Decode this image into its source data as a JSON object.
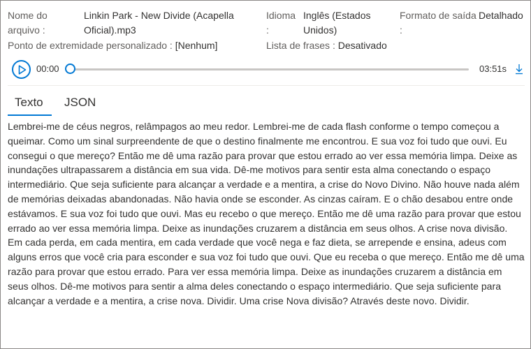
{
  "meta": {
    "filename_label": "Nome do arquivo :",
    "filename_value": "Linkin Park - New Divide (Acapella Oficial).mp3",
    "language_label": "Idioma :",
    "language_value": "Inglês (Estados Unidos)",
    "output_label": "Formato de saída :",
    "output_value": "Detalhado",
    "endpoint_label": "Ponto de extremidade personalizado :",
    "endpoint_value": "[Nenhum]",
    "phrases_label": "Lista de frases :",
    "phrases_value": "Desativado"
  },
  "player": {
    "current_time": "00:00",
    "total_time": "03:51s",
    "progress": 0,
    "play_icon": "play-icon",
    "download_icon": "download-icon"
  },
  "tabs": [
    {
      "label": "Texto",
      "active": true
    },
    {
      "label": "JSON",
      "active": false
    }
  ],
  "transcript": "Lembrei-me de céus negros, relâmpagos ao meu redor. Lembrei-me de cada flash conforme o tempo começou a queimar. Como um sinal surpreendente de que o destino finalmente me encontrou. E sua voz foi tudo que ouvi. Eu consegui o que mereço? Então me dê uma razão para provar que estou errado ao ver essa memória limpa. Deixe as inundações ultrapassarem a distância em sua vida. Dê-me motivos para sentir esta alma conectando o espaço intermediário. Que seja suficiente para alcançar a verdade e a mentira, a crise do Novo Divino. Não houve nada além de memórias deixadas abandonadas. Não havia onde se esconder. As cinzas caíram. E o chão desabou entre onde estávamos. E sua voz foi tudo que ouvi. Mas eu recebo o que mereço. Então me dê uma razão para provar que estou errado ao ver essa memória limpa. Deixe as inundações cruzarem a distância em seus olhos. A crise nova divisão. Em cada perda, em cada mentira, em cada verdade que você nega e faz dieta, se arrepende e ensina, adeus com alguns erros que você cria para esconder e sua voz foi tudo que ouvi. Que eu receba o que mereço. Então me dê uma razão para provar que estou errado. Para ver essa memória limpa. Deixe as inundações cruzarem a distância em seus olhos. Dê-me motivos para sentir a alma deles conectando o espaço intermediário. Que seja suficiente para alcançar a verdade e a mentira, a crise nova. Dividir. Uma crise Nova divisão? Através deste novo. Dividir.",
  "colors": {
    "accent": "#0078d4",
    "text": "#323130",
    "border": "#8a8886"
  }
}
